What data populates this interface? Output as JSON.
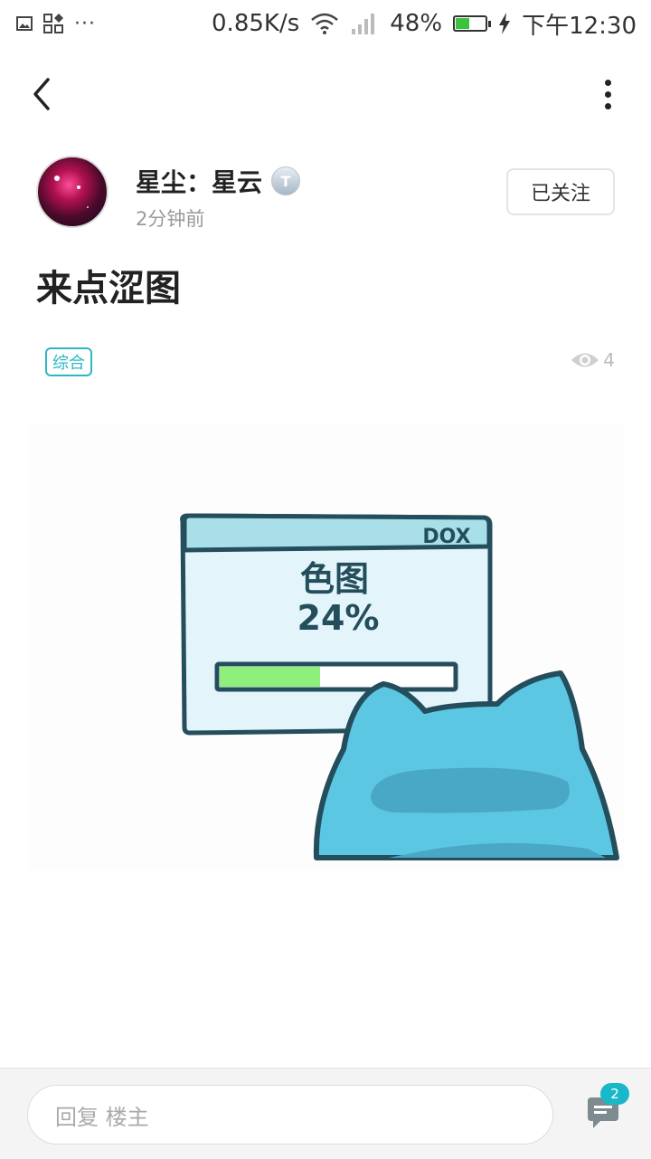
{
  "status_bar": {
    "speed": "0.85K/s",
    "battery_percent": "48%",
    "battery_level": 0.48,
    "time": "下午12:30",
    "dots": "···"
  },
  "author": {
    "name": "星尘：星云",
    "level_badge": "T",
    "time_ago": "2分钟前",
    "follow_label": "已关注"
  },
  "post": {
    "title": "来点涩图",
    "tag": "综合",
    "views": "4"
  },
  "image": {
    "window_label": "DOX",
    "line1": "色图",
    "line2": "24%",
    "progress": 0.24
  },
  "bottom_bar": {
    "reply_placeholder": "回复  楼主",
    "comment_count": "2"
  },
  "colors": {
    "accent": "#19b8c8",
    "tag": "#2bb7c4",
    "progress_fill": "#8ef07a",
    "cat": "#5cc7e3"
  }
}
